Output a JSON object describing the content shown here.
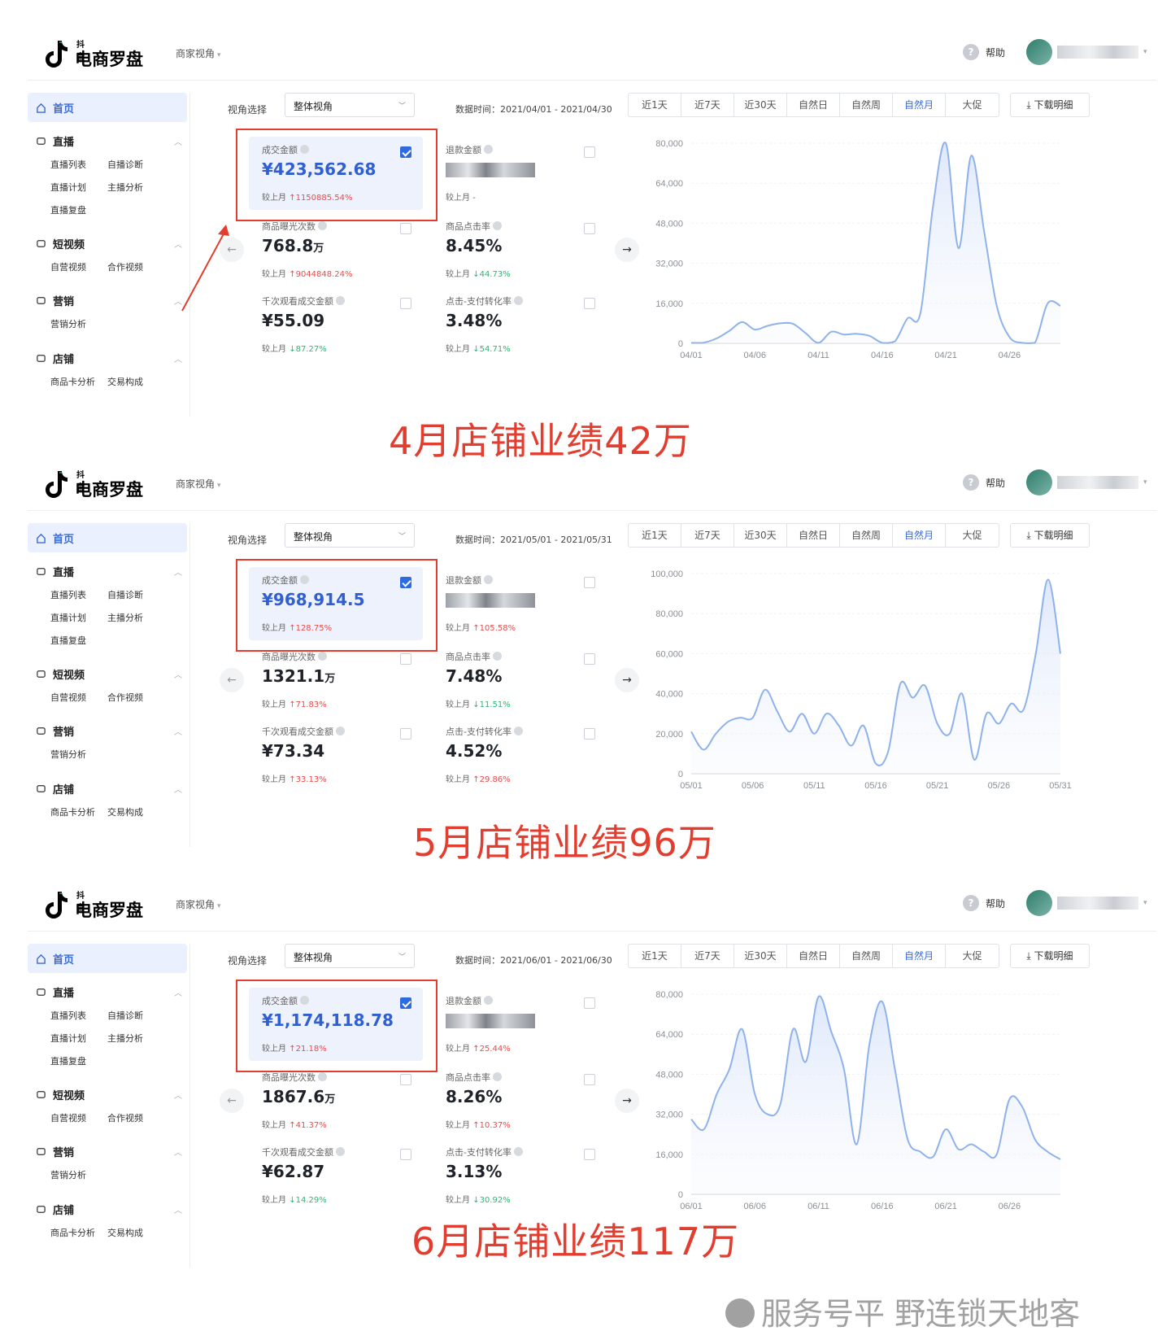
{
  "app": {
    "logo_small": "抖音",
    "logo_big": "电商罗盘",
    "perspective": "商家视角",
    "help": "帮助"
  },
  "sidebar": {
    "home": "首页",
    "sections": [
      {
        "label": "直播",
        "items": [
          "直播列表",
          "自播诊断",
          "直播计划",
          "主播分析",
          "直播复盘"
        ]
      },
      {
        "label": "短视频",
        "items": [
          "自营视频",
          "合作视频"
        ]
      },
      {
        "label": "营销",
        "items": [
          "营销分析"
        ]
      },
      {
        "label": "店铺",
        "items": [
          "商品卡分析",
          "交易构成"
        ]
      }
    ]
  },
  "toolbar": {
    "view_label": "视角选择",
    "view_value": "整体视角",
    "range_prefix": "数据时间：",
    "tabs": [
      "近1天",
      "近7天",
      "近30天",
      "自然日",
      "自然周",
      "自然月",
      "大促"
    ],
    "active_tab": "自然月",
    "download": "下载明细"
  },
  "compare_label": "较上月",
  "screens": [
    {
      "range": "2021/04/01 - 2021/04/30",
      "metrics": [
        {
          "name": "成交金额",
          "value": "¥423,562.68",
          "change": "1150885.54%",
          "dir": "up",
          "checked": true
        },
        {
          "name": "退款金额",
          "value": "",
          "change": "-",
          "dir": "none",
          "blurred": true
        },
        {
          "name": "商品曝光次数",
          "value": "768.8",
          "unit": "万",
          "change": "9044848.24%",
          "dir": "up"
        },
        {
          "name": "商品点击率",
          "value": "8.45%",
          "change": "44.73%",
          "dir": "down"
        },
        {
          "name": "千次观看成交金额",
          "value": "¥55.09",
          "change": "87.27%",
          "dir": "down"
        },
        {
          "name": "点击-支付转化率",
          "value": "3.48%",
          "change": "54.71%",
          "dir": "down"
        }
      ],
      "caption": "4月店铺业绩42万"
    },
    {
      "range": "2021/05/01 - 2021/05/31",
      "metrics": [
        {
          "name": "成交金额",
          "value": "¥968,914.5",
          "change": "128.75%",
          "dir": "up",
          "checked": true
        },
        {
          "name": "退款金额",
          "value": "",
          "change": "105.58%",
          "dir": "up",
          "blurred": true
        },
        {
          "name": "商品曝光次数",
          "value": "1321.1",
          "unit": "万",
          "change": "71.83%",
          "dir": "up"
        },
        {
          "name": "商品点击率",
          "value": "7.48%",
          "change": "11.51%",
          "dir": "down"
        },
        {
          "name": "千次观看成交金额",
          "value": "¥73.34",
          "change": "33.13%",
          "dir": "up"
        },
        {
          "name": "点击-支付转化率",
          "value": "4.52%",
          "change": "29.86%",
          "dir": "up"
        }
      ],
      "caption": "5月店铺业绩96万"
    },
    {
      "range": "2021/06/01 - 2021/06/30",
      "metrics": [
        {
          "name": "成交金额",
          "value": "¥1,174,118.78",
          "change": "21.18%",
          "dir": "up",
          "checked": true
        },
        {
          "name": "退款金额",
          "value": "",
          "change": "25.44%",
          "dir": "up",
          "blurred": true
        },
        {
          "name": "商品曝光次数",
          "value": "1867.6",
          "unit": "万",
          "change": "41.37%",
          "dir": "up"
        },
        {
          "name": "商品点击率",
          "value": "8.26%",
          "change": "10.37%",
          "dir": "up"
        },
        {
          "name": "千次观看成交金额",
          "value": "¥62.87",
          "change": "14.29%",
          "dir": "down"
        },
        {
          "name": "点击-支付转化率",
          "value": "3.13%",
          "change": "30.92%",
          "dir": "down"
        }
      ],
      "caption": "6月店铺业绩117万"
    }
  ],
  "chart_data": [
    {
      "type": "area",
      "ylim": [
        0,
        80000
      ],
      "yticks": [
        "0",
        "16,000",
        "32,000",
        "48,000",
        "64,000",
        "80,000"
      ],
      "xticks": [
        "04/01",
        "04/06",
        "04/11",
        "04/16",
        "04/21",
        "04/26"
      ],
      "x": [
        "04/01",
        "04/02",
        "04/03",
        "04/04",
        "04/05",
        "04/06",
        "04/07",
        "04/08",
        "04/09",
        "04/10",
        "04/11",
        "04/12",
        "04/13",
        "04/14",
        "04/15",
        "04/16",
        "04/17",
        "04/18",
        "04/19",
        "04/20",
        "04/21",
        "04/22",
        "04/23",
        "04/24",
        "04/25",
        "04/26",
        "04/27",
        "04/28",
        "04/29",
        "04/30"
      ],
      "series": [
        {
          "values": [
            200,
            300,
            2000,
            5000,
            8500,
            5500,
            7000,
            8000,
            7800,
            4000,
            200,
            4600,
            3500,
            3800,
            3000,
            200,
            800,
            10000,
            12000,
            55000,
            80000,
            38000,
            75000,
            45000,
            15000,
            2500,
            200,
            200,
            16000,
            15000
          ]
        }
      ]
    },
    {
      "type": "area",
      "ylim": [
        0,
        100000
      ],
      "yticks": [
        "0",
        "20,000",
        "40,000",
        "60,000",
        "80,000",
        "100,000"
      ],
      "xticks": [
        "05/01",
        "05/06",
        "05/11",
        "05/16",
        "05/21",
        "05/26",
        "05/31"
      ],
      "x": [
        "05/01",
        "05/02",
        "05/03",
        "05/04",
        "05/05",
        "05/06",
        "05/07",
        "05/08",
        "05/09",
        "05/10",
        "05/11",
        "05/12",
        "05/13",
        "05/14",
        "05/15",
        "05/16",
        "05/17",
        "05/18",
        "05/19",
        "05/20",
        "05/21",
        "05/22",
        "05/23",
        "05/24",
        "05/25",
        "05/26",
        "05/27",
        "05/28",
        "05/29",
        "05/30",
        "05/31"
      ],
      "series": [
        {
          "values": [
            21000,
            12000,
            20000,
            26000,
            28000,
            28000,
            42000,
            31000,
            21000,
            30000,
            20000,
            30000,
            24000,
            14000,
            24000,
            5000,
            11000,
            45000,
            38000,
            44000,
            25000,
            20000,
            40000,
            7000,
            30000,
            25000,
            35000,
            32000,
            60000,
            97000,
            60000
          ]
        }
      ]
    },
    {
      "type": "area",
      "ylim": [
        0,
        80000
      ],
      "yticks": [
        "0",
        "16,000",
        "32,000",
        "48,000",
        "64,000",
        "80,000"
      ],
      "xticks": [
        "06/01",
        "06/06",
        "06/11",
        "06/16",
        "06/21",
        "06/26"
      ],
      "x": [
        "06/01",
        "06/02",
        "06/03",
        "06/04",
        "06/05",
        "06/06",
        "06/07",
        "06/08",
        "06/09",
        "06/10",
        "06/11",
        "06/12",
        "06/13",
        "06/14",
        "06/15",
        "06/16",
        "06/17",
        "06/18",
        "06/19",
        "06/20",
        "06/21",
        "06/22",
        "06/23",
        "06/24",
        "06/25",
        "06/26",
        "06/27",
        "06/28",
        "06/29",
        "06/30"
      ],
      "series": [
        {
          "values": [
            30000,
            26000,
            40000,
            50000,
            66000,
            40000,
            32000,
            36000,
            66000,
            53000,
            79000,
            65000,
            50000,
            20000,
            60000,
            77000,
            50000,
            22000,
            17000,
            15000,
            26000,
            18000,
            20000,
            17000,
            16000,
            38000,
            35000,
            22000,
            17000,
            14000
          ]
        }
      ]
    }
  ],
  "watermark": "服务号平 野连锁天地客",
  "colors": {
    "accent": "#3a6bd8",
    "up": "#f04848",
    "down": "#2bb673",
    "highlight": "#e23d2e",
    "line": "#8fb2ec"
  }
}
